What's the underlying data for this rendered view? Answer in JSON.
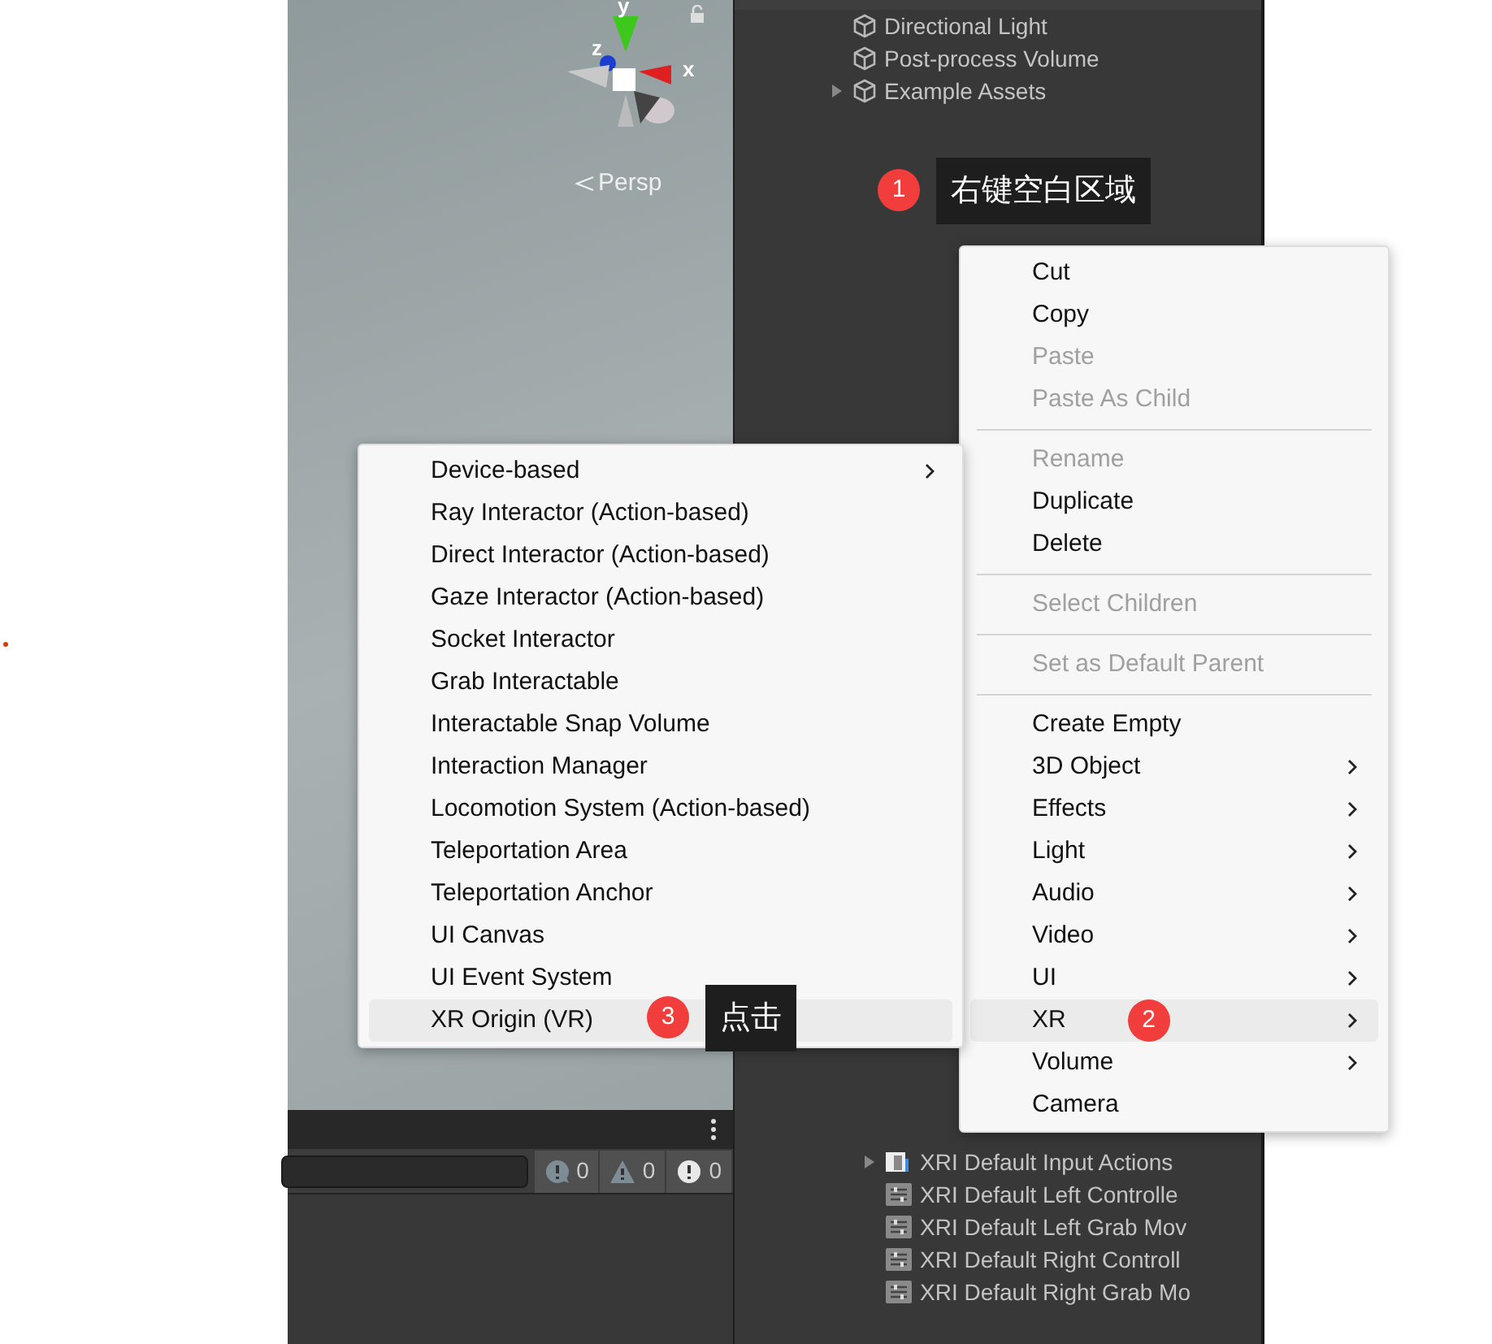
{
  "scene": {
    "view_label": "Persp",
    "axes": [
      "y",
      "z",
      "x"
    ]
  },
  "hierarchy": {
    "items": [
      {
        "label": "Directional Light",
        "expandable": false
      },
      {
        "label": "Post-process Volume",
        "expandable": false
      },
      {
        "label": "Example Assets",
        "expandable": true
      }
    ],
    "asset_items": [
      {
        "label": "XRI Default Input Actions",
        "expandable": true,
        "kind": "actions"
      },
      {
        "label": "XRI Default Left Controlle",
        "expandable": false,
        "kind": "preset"
      },
      {
        "label": "XRI Default Left Grab Mov",
        "expandable": false,
        "kind": "preset"
      },
      {
        "label": "XRI Default Right Controll",
        "expandable": false,
        "kind": "preset"
      },
      {
        "label": "XRI Default Right Grab Mo",
        "expandable": false,
        "kind": "preset"
      }
    ]
  },
  "console": {
    "counts": [
      {
        "kind": "info",
        "value": "0"
      },
      {
        "kind": "warning",
        "value": "0"
      },
      {
        "kind": "error",
        "value": "0"
      }
    ]
  },
  "context_menu": {
    "items": [
      {
        "kind": "item",
        "label": "Cut",
        "disabled": false,
        "submenu": false,
        "selected": false
      },
      {
        "kind": "item",
        "label": "Copy",
        "disabled": false,
        "submenu": false,
        "selected": false
      },
      {
        "kind": "item",
        "label": "Paste",
        "disabled": true,
        "submenu": false,
        "selected": false
      },
      {
        "kind": "item",
        "label": "Paste As Child",
        "disabled": true,
        "submenu": false,
        "selected": false
      },
      {
        "kind": "separator"
      },
      {
        "kind": "item",
        "label": "Rename",
        "disabled": true,
        "submenu": false,
        "selected": false
      },
      {
        "kind": "item",
        "label": "Duplicate",
        "disabled": false,
        "submenu": false,
        "selected": false
      },
      {
        "kind": "item",
        "label": "Delete",
        "disabled": false,
        "submenu": false,
        "selected": false
      },
      {
        "kind": "separator"
      },
      {
        "kind": "item",
        "label": "Select Children",
        "disabled": true,
        "submenu": false,
        "selected": false
      },
      {
        "kind": "separator"
      },
      {
        "kind": "item",
        "label": "Set as Default Parent",
        "disabled": true,
        "submenu": false,
        "selected": false
      },
      {
        "kind": "separator"
      },
      {
        "kind": "item",
        "label": "Create Empty",
        "disabled": false,
        "submenu": false,
        "selected": false
      },
      {
        "kind": "item",
        "label": "3D Object",
        "disabled": false,
        "submenu": true,
        "selected": false
      },
      {
        "kind": "item",
        "label": "Effects",
        "disabled": false,
        "submenu": true,
        "selected": false
      },
      {
        "kind": "item",
        "label": "Light",
        "disabled": false,
        "submenu": true,
        "selected": false
      },
      {
        "kind": "item",
        "label": "Audio",
        "disabled": false,
        "submenu": true,
        "selected": false
      },
      {
        "kind": "item",
        "label": "Video",
        "disabled": false,
        "submenu": true,
        "selected": false
      },
      {
        "kind": "item",
        "label": "UI",
        "disabled": false,
        "submenu": true,
        "selected": false
      },
      {
        "kind": "item",
        "label": "XR",
        "disabled": false,
        "submenu": true,
        "selected": true,
        "badge": "2"
      },
      {
        "kind": "item",
        "label": "Volume",
        "disabled": false,
        "submenu": true,
        "selected": false
      },
      {
        "kind": "item",
        "label": "Camera",
        "disabled": false,
        "submenu": false,
        "selected": false
      }
    ]
  },
  "submenu": {
    "items": [
      {
        "label": "Device-based",
        "submenu": true,
        "selected": false
      },
      {
        "label": "Ray Interactor (Action-based)",
        "submenu": false,
        "selected": false
      },
      {
        "label": "Direct Interactor (Action-based)",
        "submenu": false,
        "selected": false
      },
      {
        "label": "Gaze Interactor (Action-based)",
        "submenu": false,
        "selected": false
      },
      {
        "label": "Socket Interactor",
        "submenu": false,
        "selected": false
      },
      {
        "label": "Grab Interactable",
        "submenu": false,
        "selected": false
      },
      {
        "label": "Interactable Snap Volume",
        "submenu": false,
        "selected": false
      },
      {
        "label": "Interaction Manager",
        "submenu": false,
        "selected": false
      },
      {
        "label": "Locomotion System (Action-based)",
        "submenu": false,
        "selected": false
      },
      {
        "label": "Teleportation Area",
        "submenu": false,
        "selected": false
      },
      {
        "label": "Teleportation Anchor",
        "submenu": false,
        "selected": false
      },
      {
        "label": "UI Canvas",
        "submenu": false,
        "selected": false
      },
      {
        "label": "UI Event System",
        "submenu": false,
        "selected": false
      },
      {
        "label": "XR Origin (VR)",
        "submenu": false,
        "selected": true
      }
    ]
  },
  "annotations": [
    {
      "number": "1",
      "text": "右键空白区域"
    },
    {
      "number": "3",
      "text": "点击"
    }
  ]
}
